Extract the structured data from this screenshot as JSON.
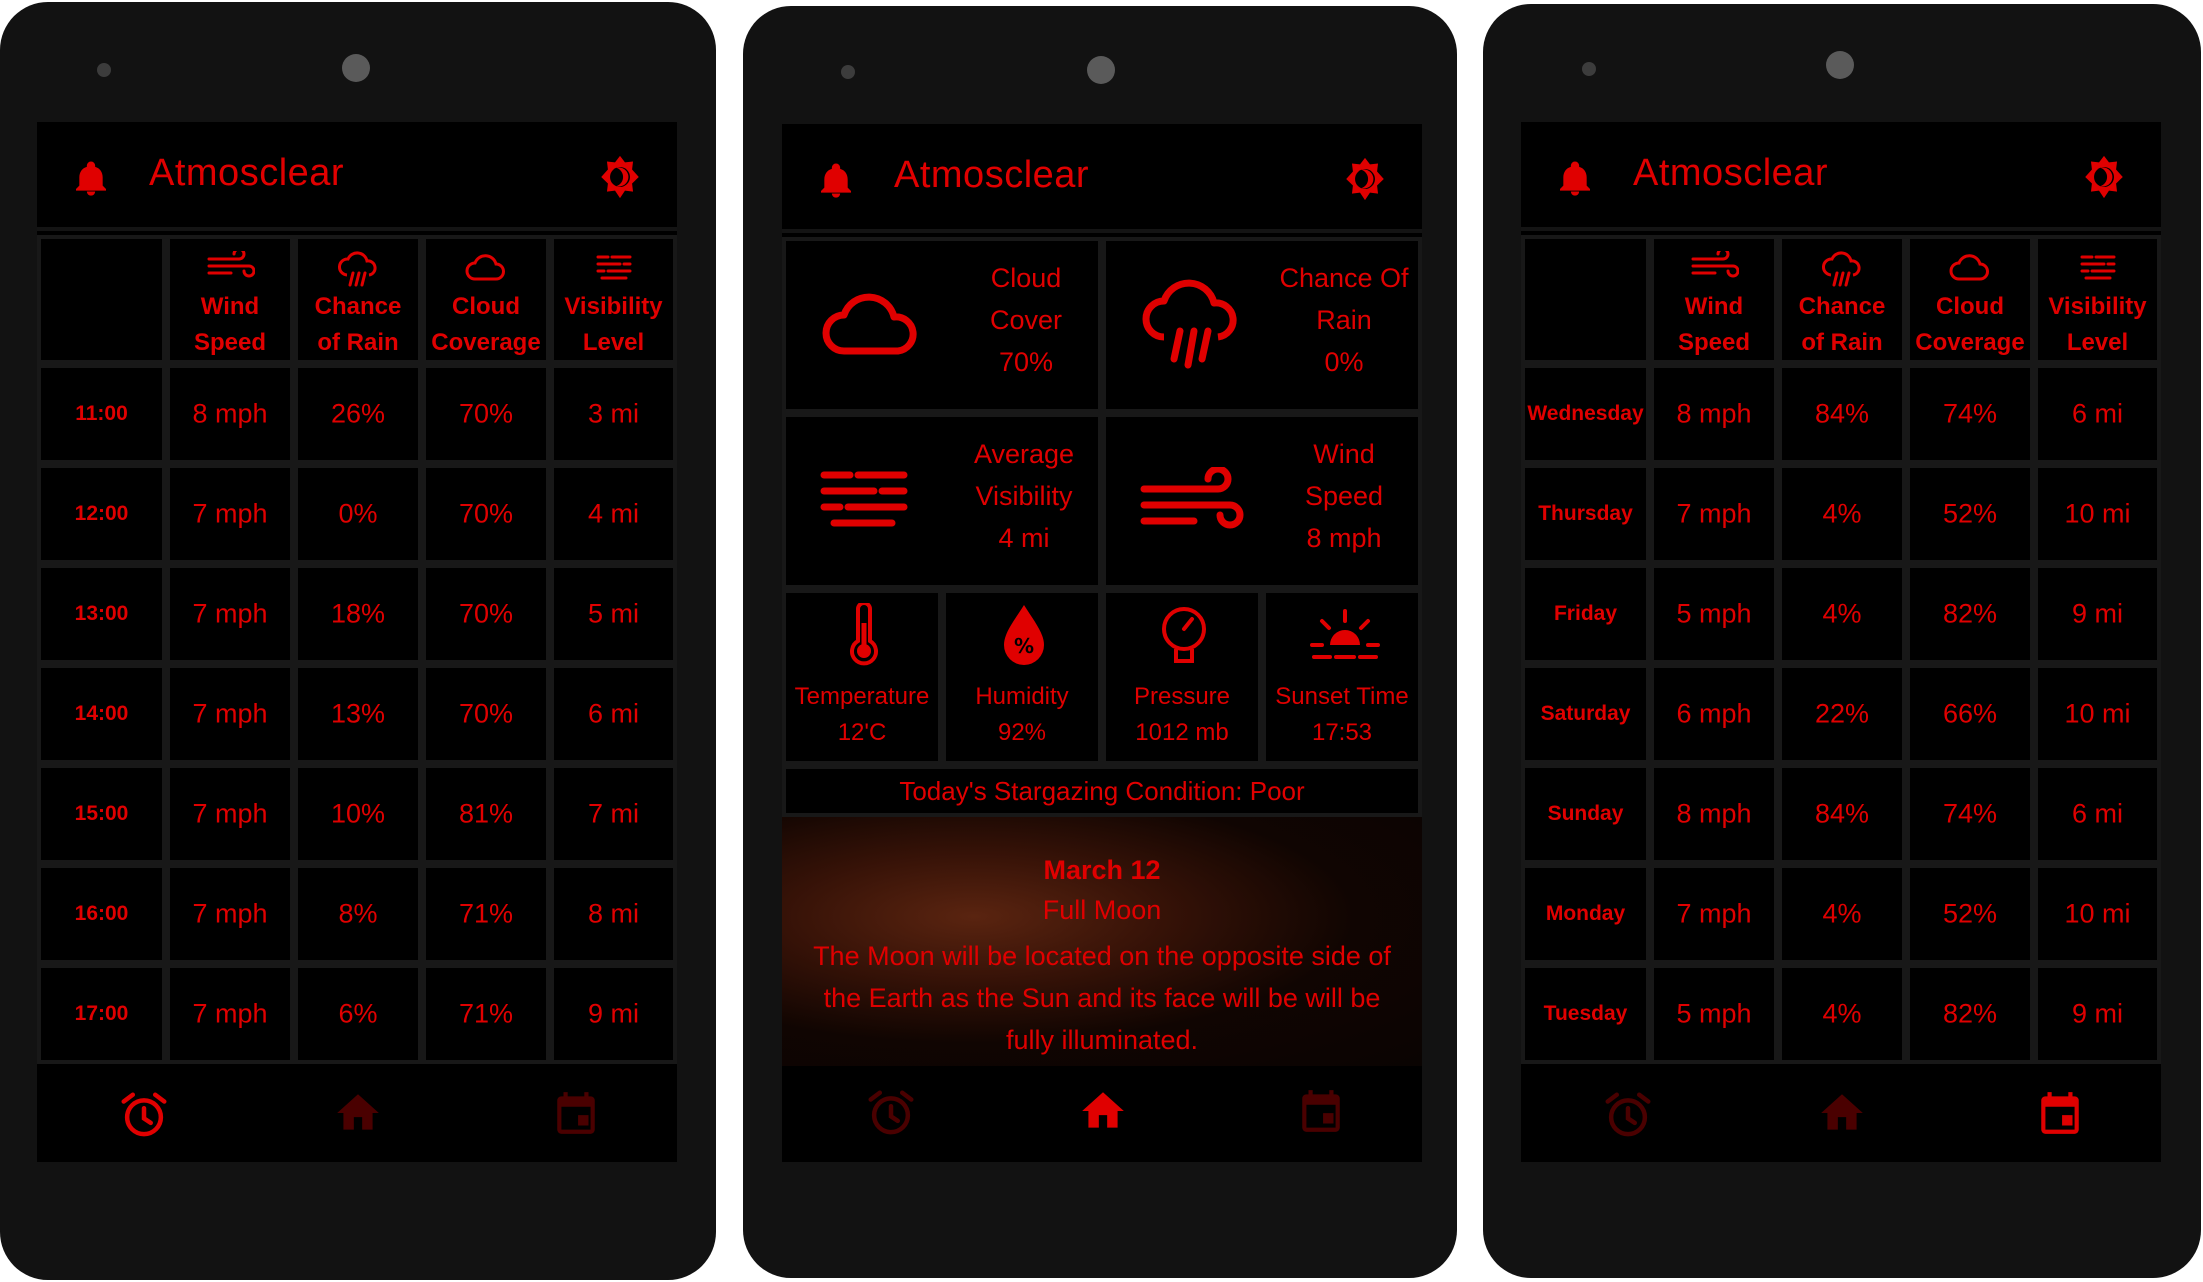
{
  "app": {
    "title": "Atmosclear"
  },
  "icons": {
    "bell": "bell-icon",
    "theme": "theme-toggle-icon",
    "wind": "wind-icon",
    "rain": "rain-cloud-icon",
    "cloud": "cloud-icon",
    "visibility": "fog-icon",
    "alarm": "alarm-clock-icon",
    "home": "home-icon",
    "calendar": "calendar-icon"
  },
  "colors": {
    "accent": "#e00000",
    "dim_accent": "#4a0000",
    "background": "#000000",
    "bezel": "#121212"
  },
  "table_headers": [
    {
      "line1": "Wind",
      "line2": "Speed"
    },
    {
      "line1": "Chance",
      "line2": "of Rain"
    },
    {
      "line1": "Cloud",
      "line2": "Coverage"
    },
    {
      "line1": "Visibility",
      "line2": "Level"
    }
  ],
  "hourly": [
    {
      "time": "11:00",
      "wind": "8 mph",
      "rain": "26%",
      "cloud": "70%",
      "vis": "3 mi"
    },
    {
      "time": "12:00",
      "wind": "7 mph",
      "rain": "0%",
      "cloud": "70%",
      "vis": "4 mi"
    },
    {
      "time": "13:00",
      "wind": "7 mph",
      "rain": "18%",
      "cloud": "70%",
      "vis": "5 mi"
    },
    {
      "time": "14:00",
      "wind": "7 mph",
      "rain": "13%",
      "cloud": "70%",
      "vis": "6 mi"
    },
    {
      "time": "15:00",
      "wind": "7 mph",
      "rain": "10%",
      "cloud": "81%",
      "vis": "7 mi"
    },
    {
      "time": "16:00",
      "wind": "7 mph",
      "rain": "8%",
      "cloud": "71%",
      "vis": "8 mi"
    },
    {
      "time": "17:00",
      "wind": "7 mph",
      "rain": "6%",
      "cloud": "71%",
      "vis": "9 mi"
    }
  ],
  "daily": [
    {
      "day": "Wednesday",
      "wind": "8 mph",
      "rain": "84%",
      "cloud": "74%",
      "vis": "6 mi"
    },
    {
      "day": "Thursday",
      "wind": "7 mph",
      "rain": "4%",
      "cloud": "52%",
      "vis": "10 mi"
    },
    {
      "day": "Friday",
      "wind": "5 mph",
      "rain": "4%",
      "cloud": "82%",
      "vis": "9 mi"
    },
    {
      "day": "Saturday",
      "wind": "6 mph",
      "rain": "22%",
      "cloud": "66%",
      "vis": "10 mi"
    },
    {
      "day": "Sunday",
      "wind": "8 mph",
      "rain": "84%",
      "cloud": "74%",
      "vis": "6 mi"
    },
    {
      "day": "Monday",
      "wind": "7 mph",
      "rain": "4%",
      "cloud": "52%",
      "vis": "10 mi"
    },
    {
      "day": "Tuesday",
      "wind": "5 mph",
      "rain": "4%",
      "cloud": "82%",
      "vis": "9 mi"
    }
  ],
  "home": {
    "cloud_cover": {
      "line1": "Cloud",
      "line2": "Cover",
      "value": "70%"
    },
    "chance_rain": {
      "line1": "Chance Of",
      "line2": "Rain",
      "value": "0%"
    },
    "avg_visibility": {
      "line1": "Average",
      "line2": "Visibility",
      "value": "4 mi"
    },
    "wind_speed": {
      "line1": "Wind",
      "line2": "Speed",
      "value": "8 mph"
    },
    "temperature": {
      "label": "Temperature",
      "value": "12'C"
    },
    "humidity": {
      "label": "Humidity",
      "value": "92%"
    },
    "pressure": {
      "label": "Pressure",
      "value": "1012 mb"
    },
    "sunset": {
      "label": "Sunset Time",
      "value": "17:53"
    },
    "stargazing": "Today's Stargazing Condition: Poor",
    "moon": {
      "date": "March 12",
      "phase": "Full Moon",
      "description": "The Moon will be located on the opposite side of the Earth as the Sun and its face will be will be fully illuminated."
    }
  }
}
